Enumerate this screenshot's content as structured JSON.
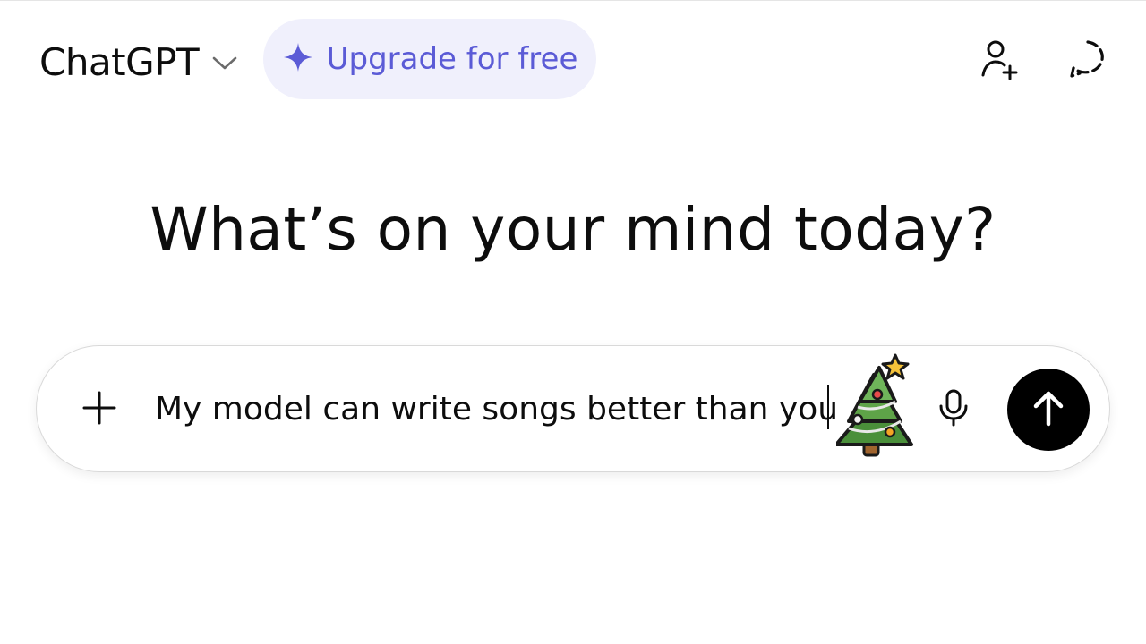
{
  "header": {
    "model_name": "ChatGPT",
    "upgrade_label": "Upgrade for free",
    "icons": {
      "model_menu": "chevron-down-icon",
      "upgrade": "sparkle-icon",
      "add_people": "add-person-icon",
      "temporary_chat": "temporary-chat-icon"
    }
  },
  "main": {
    "heading": "What’s on your mind today?"
  },
  "composer": {
    "input_value": "My model can write songs better than you",
    "icons": {
      "attach": "plus-icon",
      "sticker": "christmas-tree-icon",
      "voice": "microphone-icon",
      "send": "arrow-up-icon"
    }
  },
  "colors": {
    "accent": "#5b5bd6",
    "upgrade_bg": "#f0f0fc",
    "send_bg": "#000000",
    "text": "#0d0d0d"
  }
}
